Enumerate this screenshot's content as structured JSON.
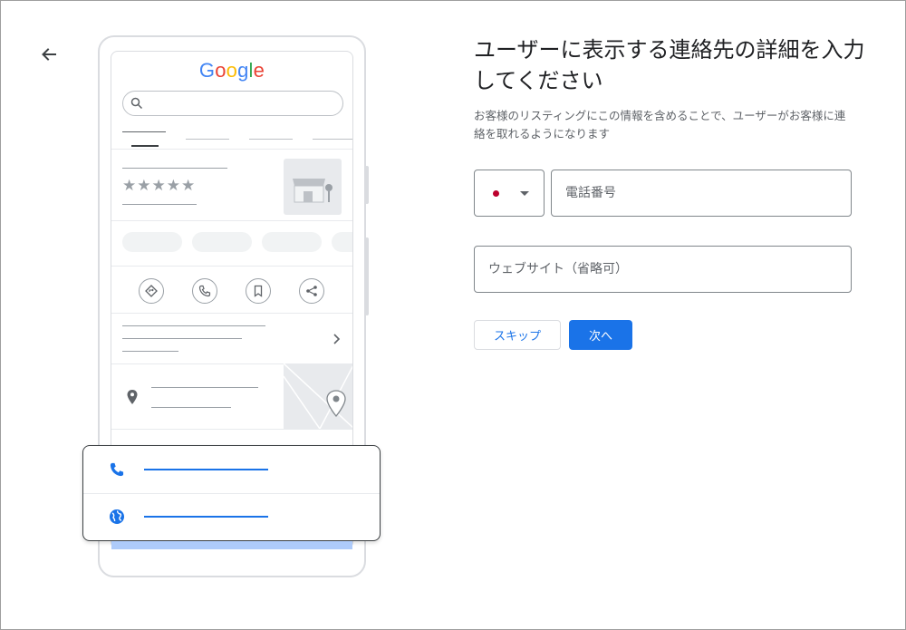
{
  "navigation": {
    "back_icon": "arrow-back-icon"
  },
  "illustration": {
    "logo_letters": [
      {
        "char": "G",
        "color": "#4285f4"
      },
      {
        "char": "o",
        "color": "#ea4335"
      },
      {
        "char": "o",
        "color": "#fbbc05"
      },
      {
        "char": "g",
        "color": "#4285f4"
      },
      {
        "char": "l",
        "color": "#34a853"
      },
      {
        "char": "e",
        "color": "#ea4335"
      }
    ],
    "stars": "★★★★★",
    "action_icons": [
      "directions-icon",
      "phone-icon",
      "bookmark-icon",
      "share-icon"
    ],
    "popup_icons": [
      "phone-icon",
      "globe-icon"
    ]
  },
  "form": {
    "title": "ユーザーに表示する連絡先の詳細を入力してください",
    "subtitle": "お客様のリスティングにこの情報を含めることで、ユーザーがお客様に連絡を取れるようになります",
    "country_flag": "japan-flag-icon",
    "phone_placeholder": "電話番号",
    "website_placeholder": "ウェブサイト（省略可）",
    "skip_label": "スキップ",
    "next_label": "次へ"
  },
  "colors": {
    "accent": "#1a73e8",
    "light_accent": "#aecbfa",
    "border": "#80868b",
    "flag_red": "#bc002d"
  }
}
